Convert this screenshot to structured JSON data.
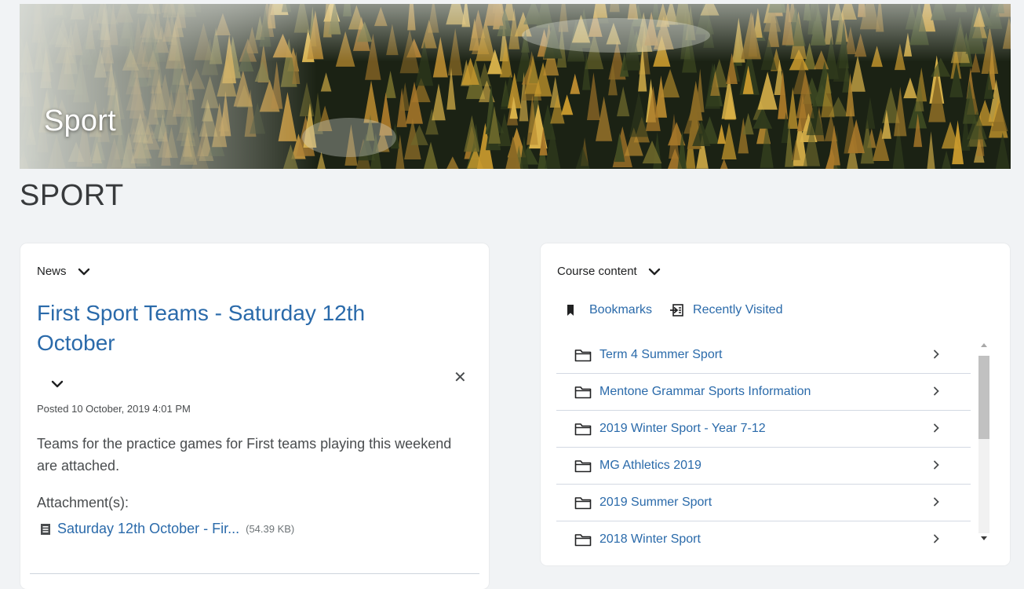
{
  "banner": {
    "title": "Sport"
  },
  "page": {
    "heading": "SPORT"
  },
  "news": {
    "widget_title": "News",
    "item": {
      "title": "First Sport Teams - Saturday 12th October",
      "posted": "Posted 10 October, 2019 4:01 PM",
      "body": "Teams for the practice games for First teams playing this weekend are attached.",
      "attachments_label": "Attachment(s):",
      "attachment": {
        "name": "Saturday 12th October - Fir...",
        "size": "(54.39 KB)"
      }
    }
  },
  "course_content": {
    "widget_title": "Course content",
    "links": {
      "bookmarks": "Bookmarks",
      "recently_visited": "Recently Visited"
    },
    "items": [
      {
        "label": "Term 4 Summer Sport"
      },
      {
        "label": "Mentone Grammar Sports Information"
      },
      {
        "label": "2019 Winter Sport - Year 7-12"
      },
      {
        "label": "MG Athletics 2019"
      },
      {
        "label": "2019 Summer Sport"
      },
      {
        "label": "2018 Winter Sport"
      }
    ]
  },
  "icons": {
    "dropdown": "chevron-down-icon",
    "close": "close-icon",
    "attachment": "document-icon",
    "bookmark": "bookmark-icon",
    "recent": "recently-visited-icon",
    "folder": "folder-icon",
    "row_arrow": "chevron-right-icon"
  },
  "colors": {
    "link": "#2a6aaa",
    "background": "#f1f3f5",
    "card": "#ffffff"
  }
}
